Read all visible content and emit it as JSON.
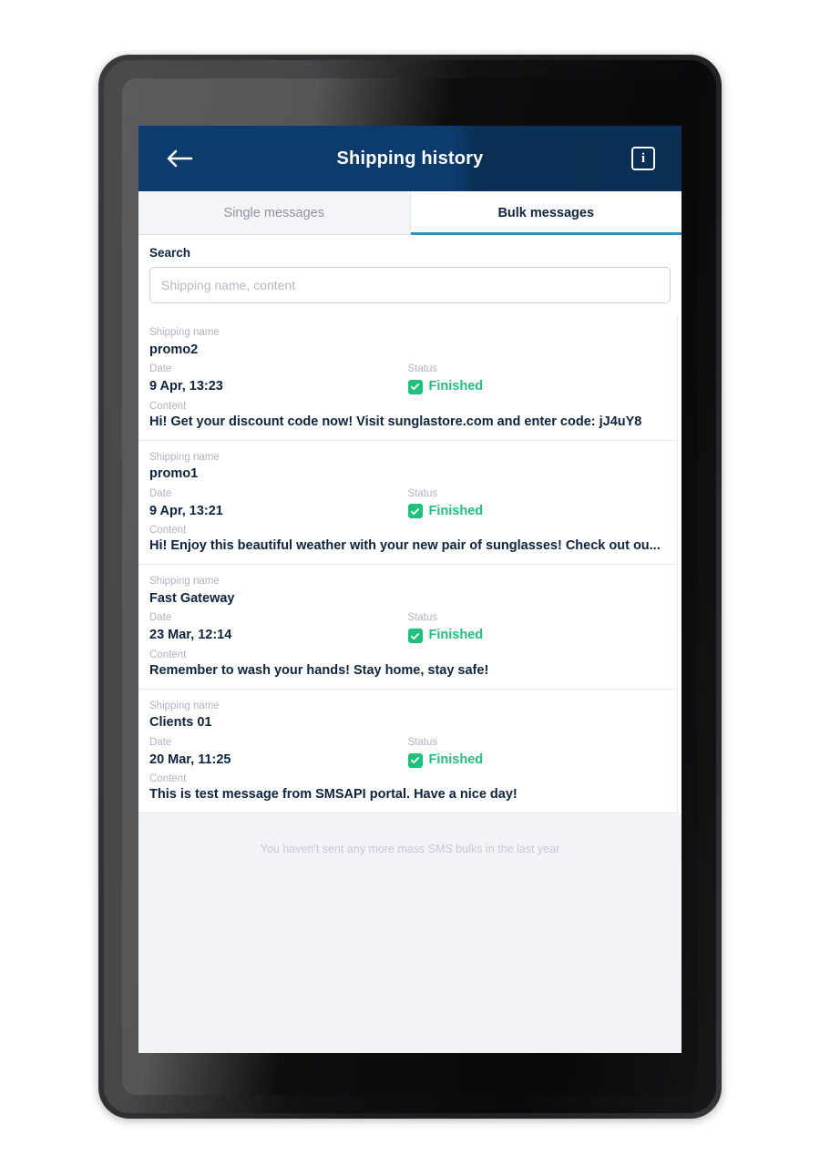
{
  "header": {
    "title": "Shipping history",
    "back_icon": "arrow-left-icon",
    "info_icon": "info-icon",
    "info_glyph": "i",
    "background_color": "#0c3b6e"
  },
  "tabs": [
    {
      "label": "Single messages",
      "active": false
    },
    {
      "label": "Bulk messages",
      "active": true
    }
  ],
  "search": {
    "label": "Search",
    "placeholder": "Shipping name, content",
    "value": ""
  },
  "labels": {
    "shipping_name": "Shipping name",
    "date": "Date",
    "status": "Status",
    "content": "Content"
  },
  "rows": [
    {
      "shipping_name": "promo2",
      "date": "9 Apr, 13:23",
      "status": "Finished",
      "status_color": "#22c07c",
      "content": "Hi! Get your discount code now! Visit sunglastore.com and enter code: jJ4uY8"
    },
    {
      "shipping_name": "promo1",
      "date": "9 Apr, 13:21",
      "status": "Finished",
      "status_color": "#22c07c",
      "content": "Hi! Enjoy this beautiful weather with your new pair of sunglasses! Check out ou..."
    },
    {
      "shipping_name": "Fast Gateway",
      "date": "23 Mar, 12:14",
      "status": "Finished",
      "status_color": "#22c07c",
      "content": "Remember to wash your hands! Stay home, stay safe!"
    },
    {
      "shipping_name": "Clients 01",
      "date": "20 Mar, 11:25",
      "status": "Finished",
      "status_color": "#22c07c",
      "content": "This is test message from SMSAPI portal. Have a nice day!"
    }
  ],
  "empty_note": "You haven't sent any more mass SMS bulks in the last year"
}
